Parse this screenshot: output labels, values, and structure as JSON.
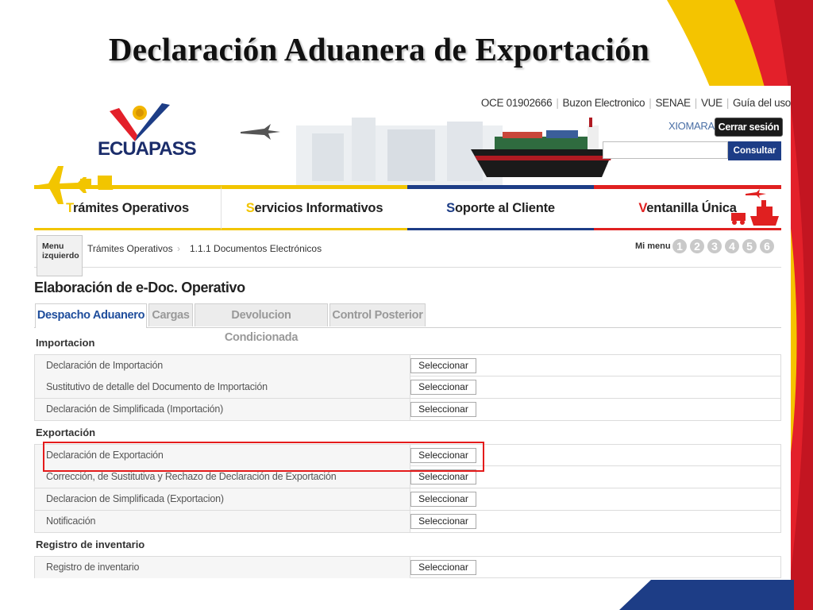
{
  "slide": {
    "title": "Declaración Aduanera de Exportación"
  },
  "header": {
    "logo": {
      "text": "ECUAPASS",
      "icon": "ecuapass-logo-icon"
    },
    "top_links": [
      "OCE  01902666",
      "Buzon Electronico",
      "SENAE",
      "VUE",
      "Guía del uso"
    ],
    "user": "XIOMARA",
    "logout_label": "Cerrar sesión",
    "search_placeholder": "",
    "search_button": "Consultar"
  },
  "nav": {
    "items": [
      {
        "first": "T",
        "rest": "rámites Operativos",
        "color": "#f2c500"
      },
      {
        "first": "S",
        "rest": "ervicios Informativos",
        "color": "#f2c500"
      },
      {
        "first": "S",
        "rest": "oporte al Cliente",
        "color": "#1d3d86"
      },
      {
        "first": "V",
        "rest": "entanilla Única",
        "color": "#e02020"
      }
    ]
  },
  "breadcrumb": {
    "menu_tab": "Menu izquierdo",
    "items": [
      "Trámites Operativos",
      "1.1.1 Documentos Electrónicos"
    ],
    "my_menu_label": "Mi menu",
    "my_menu_numbers": [
      "1",
      "2",
      "3",
      "4",
      "5",
      "6"
    ]
  },
  "page": {
    "title": "Elaboración de e-Doc. Operativo",
    "tabs": [
      "Despacho Aduanero",
      "Cargas",
      "Devolucion Condicionada",
      "Control Posterior"
    ],
    "active_tab": "Despacho Aduanero"
  },
  "sections": [
    {
      "label": "Importacion",
      "rows": [
        {
          "label": "Declaración de Importación",
          "button": "Seleccionar"
        },
        {
          "label": "Sustitutivo de detalle del Documento de Importación",
          "button": "Seleccionar"
        },
        {
          "label": "Declaración de Simplificada (Importación)",
          "button": "Seleccionar"
        }
      ]
    },
    {
      "label": "Exportación",
      "rows": [
        {
          "label": "Declaración de Exportación",
          "button": "Seleccionar",
          "highlighted": true
        },
        {
          "label": "Corrección, de Sustitutiva y Rechazo de Declaración de Exportación",
          "button": "Seleccionar"
        },
        {
          "label": "Declaracion de Simplificada (Exportacion)",
          "button": "Seleccionar"
        },
        {
          "label": "Notificación",
          "button": "Seleccionar"
        }
      ]
    },
    {
      "label": "Registro de inventario",
      "rows": [
        {
          "label": "Registro de inventario",
          "button": "Seleccionar"
        }
      ]
    }
  ],
  "colors": {
    "flag_yellow": "#f2c500",
    "flag_blue": "#1d3d86",
    "flag_red": "#e02020",
    "highlight_red": "#e41b1b",
    "active_tab_text": "#1e4d9c"
  }
}
